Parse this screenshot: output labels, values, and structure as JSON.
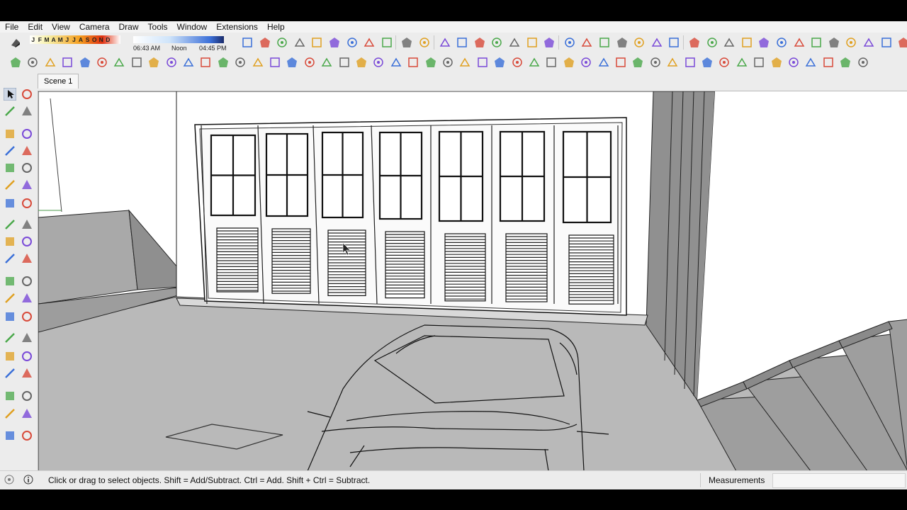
{
  "menu": [
    "File",
    "Edit",
    "View",
    "Camera",
    "Draw",
    "Tools",
    "Window",
    "Extensions",
    "Help"
  ],
  "shadow": {
    "months": [
      "J",
      "F",
      "M",
      "A",
      "M",
      "J",
      "J",
      "A",
      "S",
      "O",
      "N",
      "D"
    ],
    "time_start": "06:43 AM",
    "time_mid": "Noon",
    "time_end": "04:45 PM"
  },
  "scene_tab": "Scene 1",
  "status": {
    "message": "Click or drag to select objects. Shift = Add/Subtract. Ctrl = Add. Shift + Ctrl = Subtract.",
    "measurements_label": "Measurements",
    "measurements_value": ""
  },
  "colors": {
    "accent_blue": "#2a5bd7",
    "viewport_bg": "#ffffff",
    "ground": "#b9b9b9"
  }
}
